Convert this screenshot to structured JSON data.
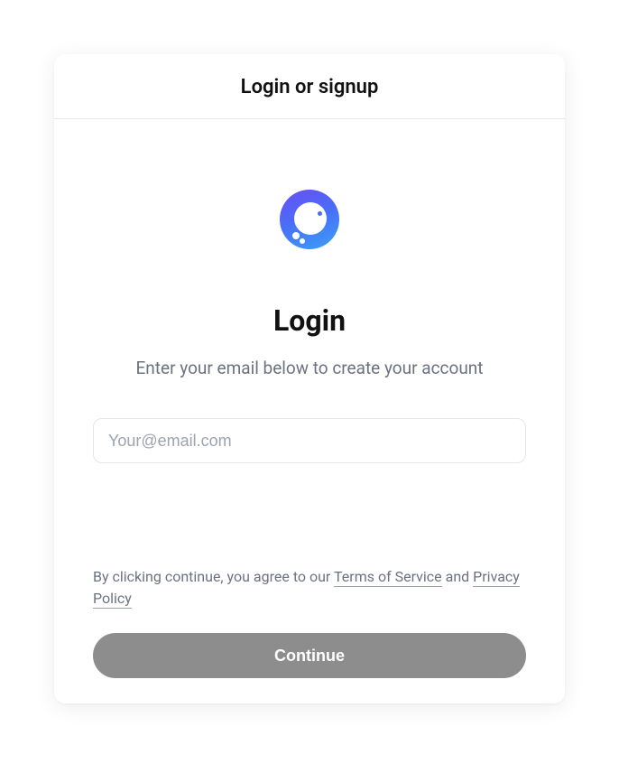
{
  "header": {
    "title": "Login or signup"
  },
  "main": {
    "title": "Login",
    "subtitle": "Enter your email below to create your account",
    "email_placeholder": "Your@email.com",
    "email_value": ""
  },
  "consent": {
    "prefix": "By clicking continue, you agree to our ",
    "terms_label": "Terms of Service",
    "and": " and ",
    "privacy_label": "Privacy Policy"
  },
  "actions": {
    "continue_label": "Continue"
  }
}
